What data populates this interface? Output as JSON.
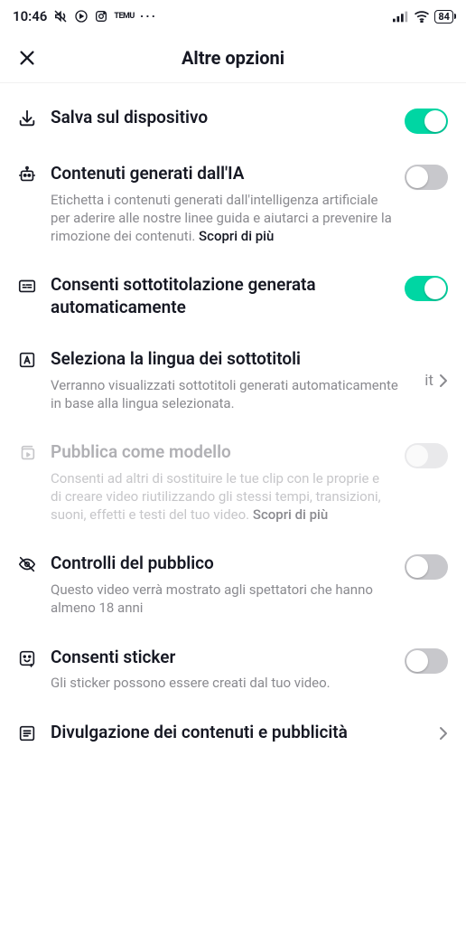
{
  "status": {
    "time": "10:46",
    "battery": "84"
  },
  "header": {
    "title": "Altre opzioni"
  },
  "rows": {
    "save": {
      "title": "Salva sul dispositivo"
    },
    "ai": {
      "title": "Contenuti generati dall'IA",
      "desc": "Etichetta i contenuti generati dall'intelligenza artificiale per aderire alle nostre linee guida e aiutarci a prevenire la rimozione dei contenuti. ",
      "more": "Scopri di più"
    },
    "captions": {
      "title": "Consenti sottotitolazione generata automaticamente"
    },
    "language": {
      "title": "Seleziona la lingua dei sottotitoli",
      "desc": "Verranno visualizzati sottotitoli generati automaticamente in base alla lingua selezionata.",
      "value": "it"
    },
    "template": {
      "title": "Pubblica come modello",
      "desc": "Consenti ad altri di sostituire le tue clip con le proprie e di creare video riutilizzando gli stessi tempi, transizioni, suoni, effetti e testi del tuo video. ",
      "more": "Scopri di più"
    },
    "audience": {
      "title": "Controlli del pubblico",
      "desc": "Questo video verrà mostrato agli spettatori che hanno almeno 18 anni"
    },
    "sticker": {
      "title": "Consenti sticker",
      "desc": "Gli sticker possono essere creati dal tuo video."
    },
    "disclosure": {
      "title": "Divulgazione dei contenuti e pubblicità"
    }
  }
}
